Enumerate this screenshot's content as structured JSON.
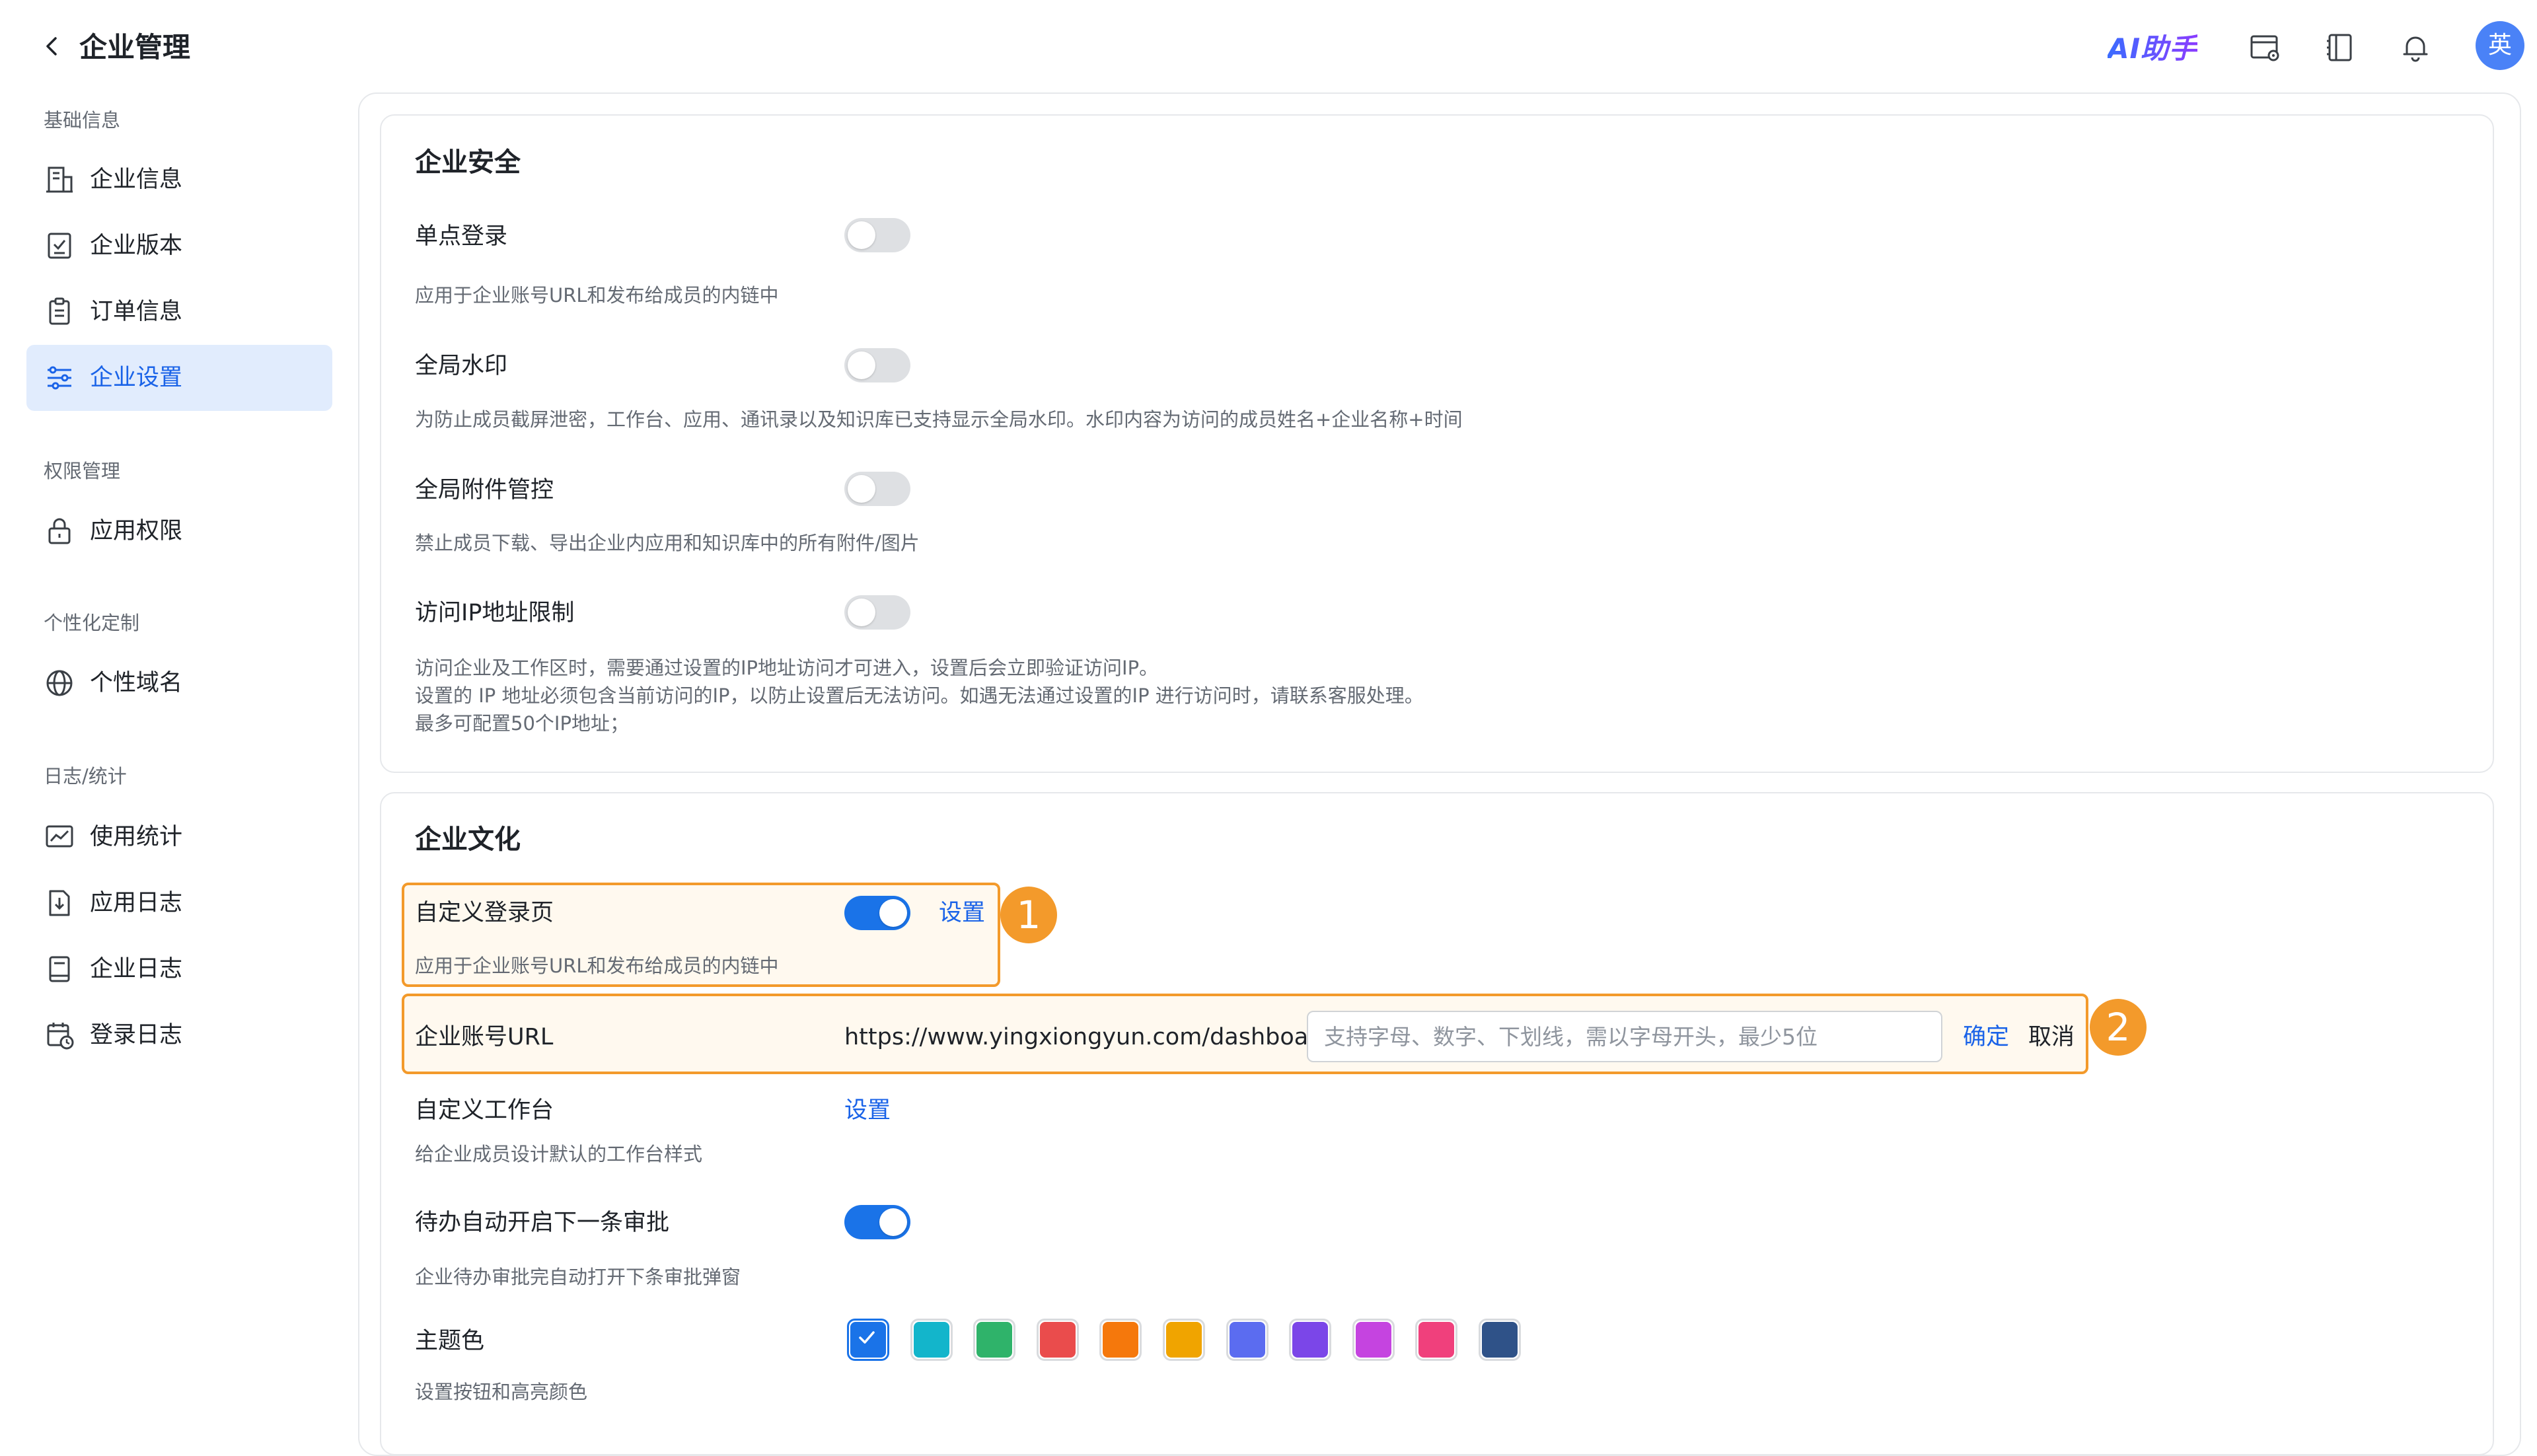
{
  "header": {
    "title": "企业管理",
    "ai_assistant": "AI助手",
    "avatar_text": "英"
  },
  "sidebar": {
    "sections": [
      {
        "label": "基础信息",
        "items": [
          {
            "label": "企业信息",
            "icon": "building-icon"
          },
          {
            "label": "企业版本",
            "icon": "version-icon"
          },
          {
            "label": "订单信息",
            "icon": "clipboard-icon"
          },
          {
            "label": "企业设置",
            "icon": "settings-sliders-icon",
            "active": true
          }
        ]
      },
      {
        "label": "权限管理",
        "items": [
          {
            "label": "应用权限",
            "icon": "lock-icon"
          }
        ]
      },
      {
        "label": "个性化定制",
        "items": [
          {
            "label": "个性域名",
            "icon": "globe-icon"
          }
        ]
      },
      {
        "label": "日志/统计",
        "items": [
          {
            "label": "使用统计",
            "icon": "line-chart-icon"
          },
          {
            "label": "应用日志",
            "icon": "download-doc-icon"
          },
          {
            "label": "企业日志",
            "icon": "notebook-icon"
          },
          {
            "label": "登录日志",
            "icon": "calendar-clock-icon"
          }
        ]
      }
    ]
  },
  "security": {
    "title": "企业安全",
    "sso": {
      "label": "单点登录",
      "desc": "应用于企业账号URL和发布给成员的内链中",
      "enabled": false
    },
    "watermark": {
      "label": "全局水印",
      "desc": "为防止成员截屏泄密，工作台、应用、通讯录以及知识库已支持显示全局水印。水印内容为访问的成员姓名+企业名称+时间",
      "enabled": false
    },
    "attachment": {
      "label": "全局附件管控",
      "desc": "禁止成员下载、导出企业内应用和知识库中的所有附件/图片",
      "enabled": false
    },
    "ip_limit": {
      "label": "访问IP地址限制",
      "desc_lines": [
        "访问企业及工作区时，需要通过设置的IP地址访问才可进入，设置后会立即验证访问IP。",
        "设置的 IP 地址必须包含当前访问的IP，以防止设置后无法访问。如遇无法通过设置的IP 进行访问时，请联系客服处理。",
        "最多可配置50个IP地址；"
      ],
      "enabled": false
    }
  },
  "culture": {
    "title": "企业文化",
    "custom_login": {
      "label": "自定义登录页",
      "desc": "应用于企业账号URL和发布给成员的内链中",
      "enabled": true,
      "link": "设置",
      "badge": "1"
    },
    "account_url": {
      "label": "企业账号URL",
      "prefix": "https://www.yingxiongyun.com/dashboard/",
      "value": "",
      "placeholder": "支持字母、数字、下划线，需以字母开头，最少5位",
      "confirm": "确定",
      "cancel": "取消",
      "badge": "2"
    },
    "custom_workbench": {
      "label": "自定义工作台",
      "desc": "给企业成员设计默认的工作台样式",
      "link": "设置"
    },
    "auto_next": {
      "label": "待办自动开启下一条审批",
      "desc": "企业待办审批完自动打开下条审批弹窗",
      "enabled": true
    },
    "theme": {
      "label": "主题色",
      "desc": "设置按钮和高亮颜色",
      "selected_index": 0,
      "colors": [
        "#1a73e8",
        "#13b5cb",
        "#2fb36a",
        "#ea4c4c",
        "#f5780c",
        "#f0a400",
        "#5b6cf0",
        "#7b46e8",
        "#c544e0",
        "#f0407c",
        "#2f5288"
      ]
    }
  }
}
